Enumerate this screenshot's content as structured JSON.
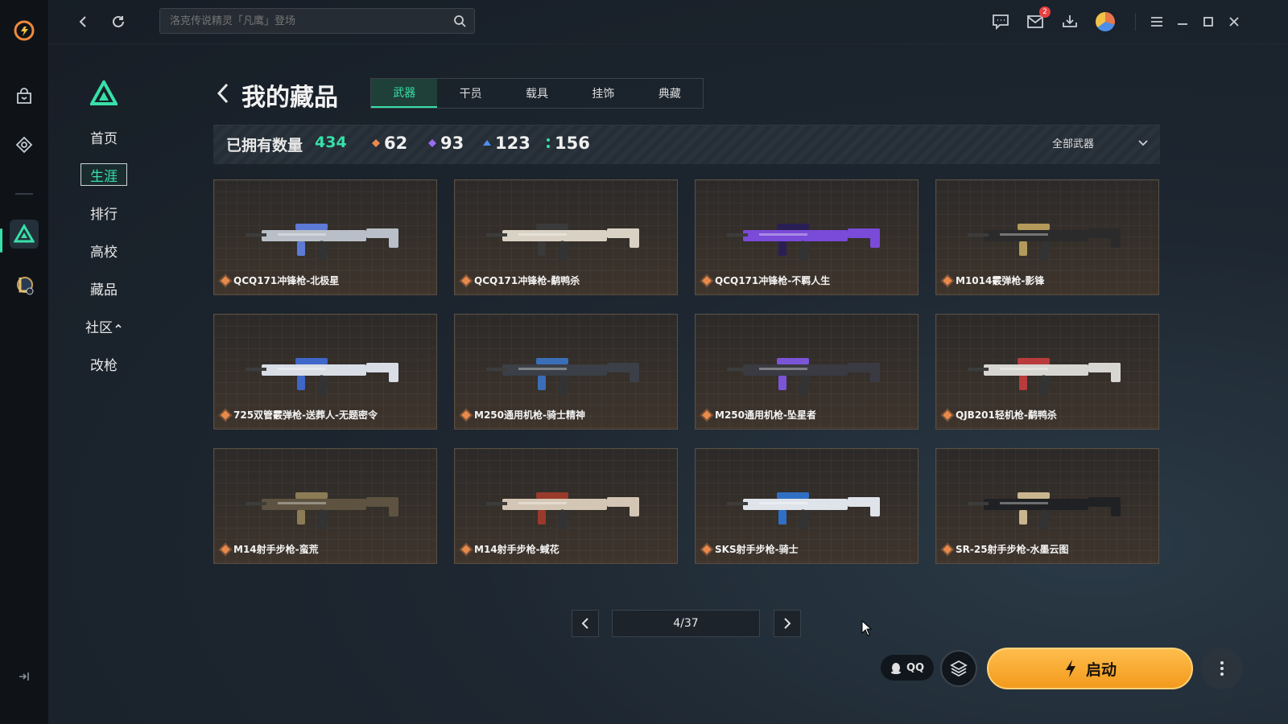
{
  "app": {
    "brand_color": "#e8773a",
    "accent": "#37e0a8",
    "search_placeholder": "洛克传说精灵「凡鹰」登场"
  },
  "topbar": {
    "mail_badge": "2"
  },
  "nav": {
    "items": [
      {
        "label": "首页",
        "active": false
      },
      {
        "label": "生涯",
        "active": true
      },
      {
        "label": "排行",
        "active": false
      },
      {
        "label": "高校",
        "active": false
      },
      {
        "label": "藏品",
        "active": false
      },
      {
        "label": "社区",
        "active": false
      },
      {
        "label": "改枪",
        "active": false
      }
    ]
  },
  "page": {
    "title": "我的藏品",
    "tabs": [
      "武器",
      "干员",
      "载具",
      "挂饰",
      "典藏"
    ],
    "active_tab": "武器"
  },
  "stats": {
    "owned_label": "已拥有数量",
    "owned_count": "434",
    "rarity_counts": [
      {
        "value": "62",
        "color": "#e98a4a"
      },
      {
        "value": "93",
        "color": "#9a6cf0"
      },
      {
        "value": "123",
        "color": "#4f8ef0"
      },
      {
        "value": "156",
        "color": "#37e0a8"
      }
    ],
    "filter_label": "全部武器"
  },
  "items": [
    {
      "name": "QCQ171冲锋枪-北极星",
      "color": "#b8bfc8",
      "accent": "#5d7bd6"
    },
    {
      "name": "QCQ171冲锋枪-鹬鸭杀",
      "color": "#d9d2c4",
      "accent": "#3a3a3a"
    },
    {
      "name": "QCQ171冲锋枪-不羁人生",
      "color": "#7a4ad8",
      "accent": "#2a1f55"
    },
    {
      "name": "M1014霰弹枪-影锋",
      "color": "#2b2b2b",
      "accent": "#b49a5a"
    },
    {
      "name": "725双管霰弹枪-送葬人-无题密令",
      "color": "#d8dde6",
      "accent": "#3f66c9"
    },
    {
      "name": "M250通用机枪-骑士精神",
      "color": "#3b3f47",
      "accent": "#3a6fb8"
    },
    {
      "name": "M250通用机枪-坠星者",
      "color": "#3a3a42",
      "accent": "#7b55d8"
    },
    {
      "name": "QJB201轻机枪-鹬鸭杀",
      "color": "#d8d6d2",
      "accent": "#b93b3b"
    },
    {
      "name": "M14射手步枪-蛮荒",
      "color": "#5d5340",
      "accent": "#8c7c55"
    },
    {
      "name": "M14射手步枪-蜮花",
      "color": "#d4c6b4",
      "accent": "#9a3a2a"
    },
    {
      "name": "SKS射手步枪-骑士",
      "color": "#dfe3ea",
      "accent": "#2f6fc4"
    },
    {
      "name": "SR-25射手步枪-水墨云图",
      "color": "#202124",
      "accent": "#c9b68e"
    }
  ],
  "pagination": {
    "label": "4/37"
  },
  "footer": {
    "qq_label": "QQ",
    "launch_label": "启动"
  }
}
